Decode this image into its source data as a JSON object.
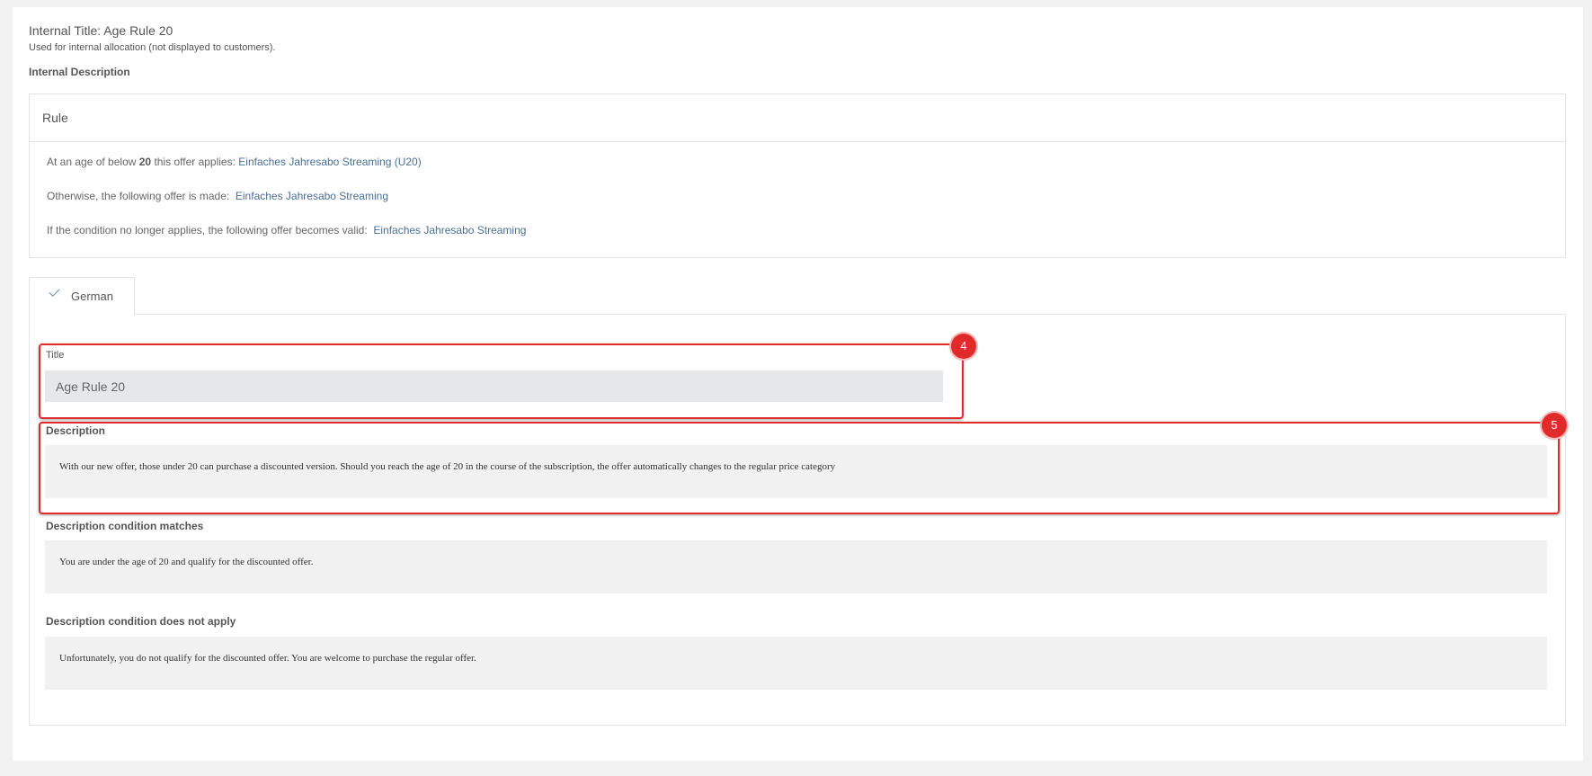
{
  "header": {
    "internal_title": "Internal Title: Age Rule 20",
    "internal_subtitle": "Used for internal allocation (not displayed to customers).",
    "internal_description_label": "Internal Description"
  },
  "rule": {
    "heading": "Rule",
    "line1_prefix": "At an age of below ",
    "line1_age": "20",
    "line1_suffix": " this offer applies: ",
    "line1_link": "Einfaches Jahresabo Streaming (U20)",
    "line2_prefix": "Otherwise, the following offer is made:  ",
    "line2_link": "Einfaches Jahresabo Streaming",
    "line3_prefix": "If the condition no longer applies, the following offer becomes valid:  ",
    "line3_link": "Einfaches Jahresabo Streaming"
  },
  "tabs": [
    {
      "label": "German",
      "active": true,
      "icon": "check-icon"
    }
  ],
  "form": {
    "title_label": "Title",
    "title_value": "Age Rule 20",
    "description_label": "Description",
    "description_text": "With our new offer, those under 20 can purchase a discounted version. Should you reach the age of 20 in the course of the subscription, the offer automatically changes to the regular price category",
    "matches_label": "Description condition matches",
    "matches_text": "You are under the age of 20 and qualify for the discounted offer.",
    "not_apply_label": "Description condition does not apply",
    "not_apply_text": "Unfortunately, you do not qualify for the discounted offer. You are welcome to purchase the regular offer."
  },
  "annotations": [
    {
      "number": "4"
    },
    {
      "number": "5"
    }
  ],
  "colors": {
    "highlight": "#e12b2b",
    "link": "#4a6f93",
    "background": "#f2f2f2"
  }
}
